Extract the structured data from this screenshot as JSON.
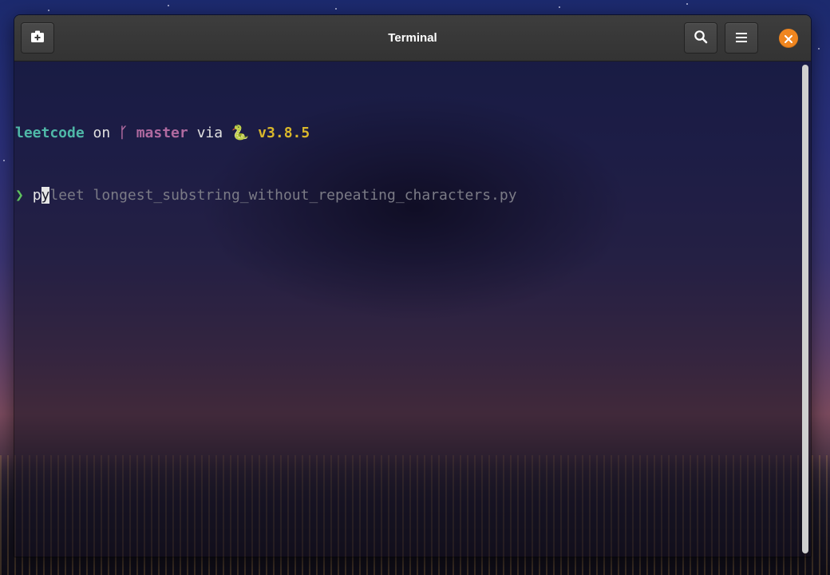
{
  "window": {
    "title": "Terminal"
  },
  "headerbar": {
    "new_tab_icon": "new-tab-icon",
    "search_icon": "search-icon",
    "menu_icon": "hamburger-menu-icon",
    "close_icon": "close-icon"
  },
  "terminal": {
    "prompt_line": {
      "directory": "leetcode",
      "on_word": " on ",
      "branch_icon": "ᚴ",
      "branch": " master",
      "via_word": " via ",
      "python_icon": "🐍",
      "version": " v3.8.5"
    },
    "command_line": {
      "prompt_symbol": "❯",
      "typed_before_cursor": "p",
      "cursor_char": "y",
      "suggestion": "leet longest_substring_without_repeating_characters.py"
    }
  },
  "colors": {
    "directory": "#4fb8a8",
    "branch": "#b06aa0",
    "version": "#d9b72b",
    "prompt": "#5ec15e",
    "close_button": "#f0861f"
  }
}
